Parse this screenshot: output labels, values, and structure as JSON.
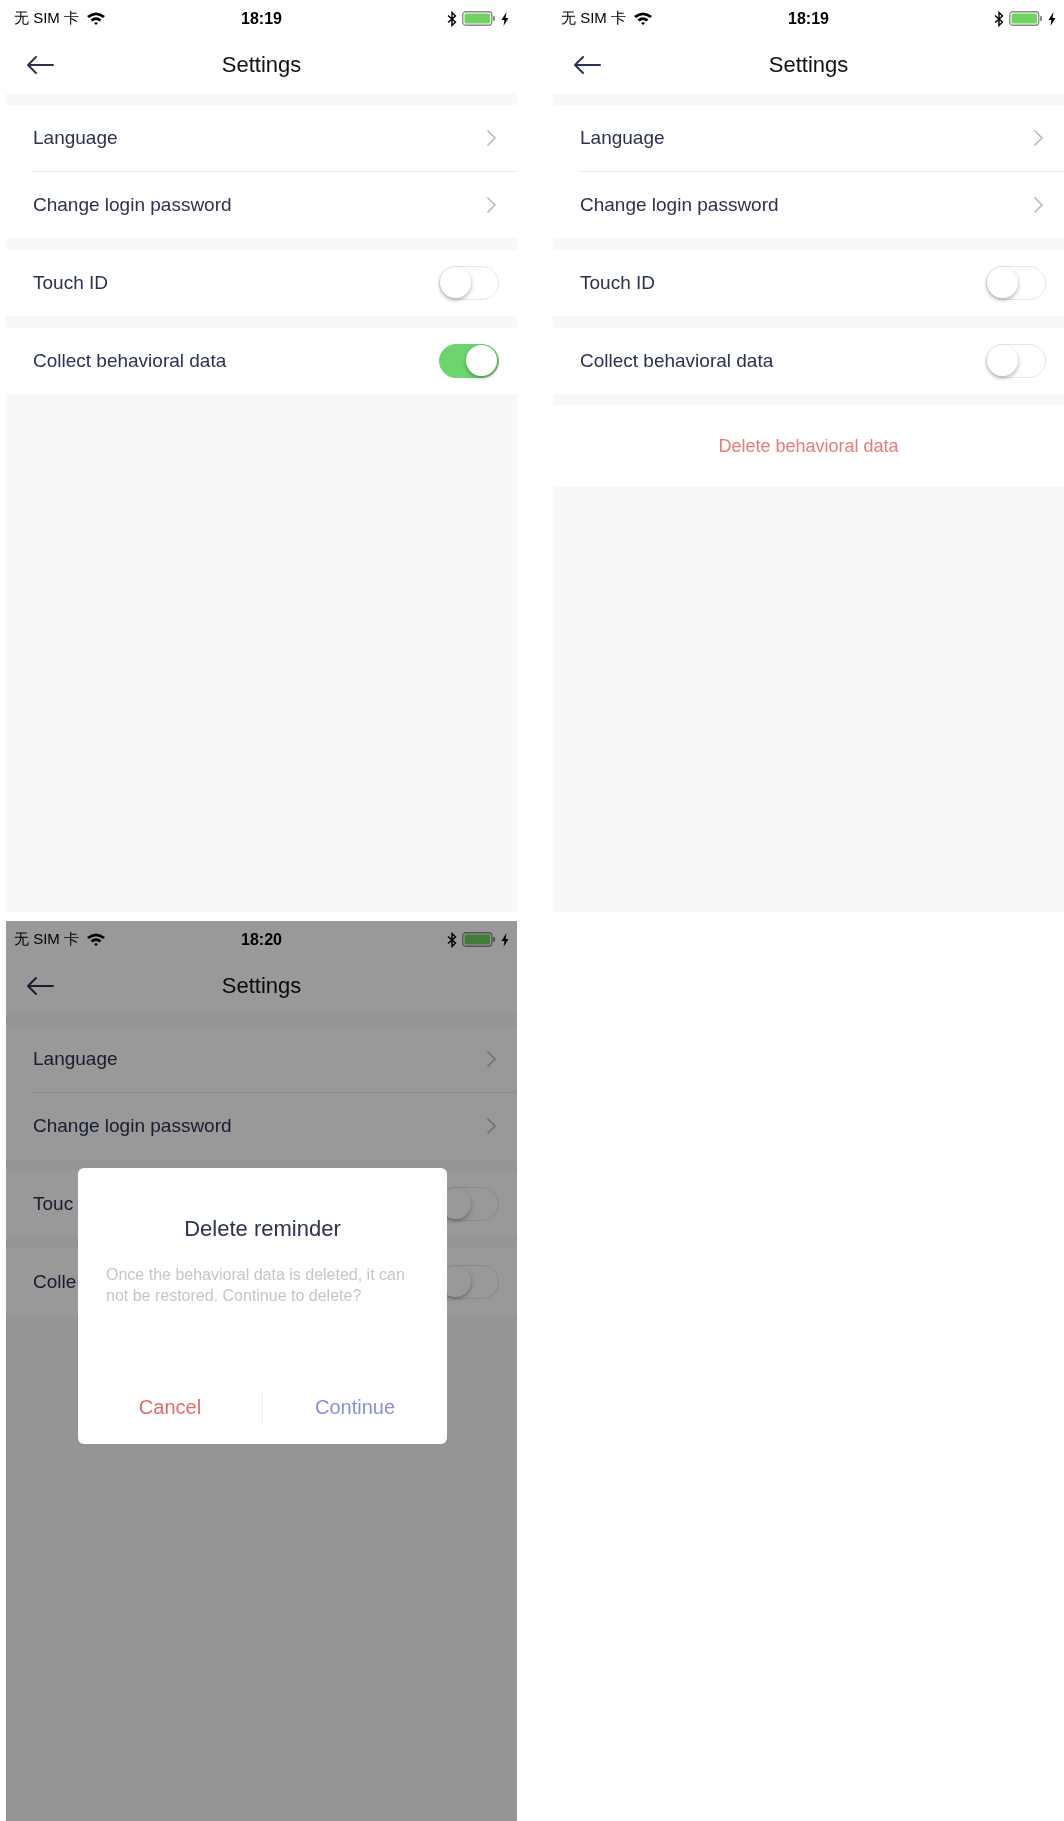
{
  "screens": [
    {
      "status_bar": {
        "carrier": "无 SIM 卡",
        "time": "18:19"
      },
      "title": "Settings",
      "groups": [
        {
          "items": [
            {
              "kind": "link",
              "label": "Language"
            },
            {
              "kind": "link",
              "label": "Change login password"
            }
          ]
        },
        {
          "items": [
            {
              "kind": "toggle",
              "label": "Touch ID",
              "on": false
            }
          ]
        },
        {
          "items": [
            {
              "kind": "toggle",
              "label": "Collect behavioral data",
              "on": true
            }
          ]
        }
      ]
    },
    {
      "status_bar": {
        "carrier": "无 SIM 卡",
        "time": "18:19"
      },
      "title": "Settings",
      "groups": [
        {
          "items": [
            {
              "kind": "link",
              "label": "Language"
            },
            {
              "kind": "link",
              "label": "Change login password"
            }
          ]
        },
        {
          "items": [
            {
              "kind": "toggle",
              "label": "Touch ID",
              "on": false
            }
          ]
        },
        {
          "items": [
            {
              "kind": "toggle",
              "label": "Collect behavioral data",
              "on": false
            }
          ]
        }
      ],
      "action": {
        "label": "Delete behavioral data"
      }
    },
    {
      "status_bar": {
        "carrier": "无 SIM 卡",
        "time": "18:20"
      },
      "title": "Settings",
      "groups": [
        {
          "items": [
            {
              "kind": "link",
              "label": "Language"
            },
            {
              "kind": "link",
              "label": "Change login password"
            }
          ]
        },
        {
          "items": [
            {
              "kind": "toggle",
              "label": "Touc",
              "on": false
            }
          ]
        },
        {
          "items": [
            {
              "kind": "toggle",
              "label": "Colle",
              "on": false
            }
          ]
        }
      ],
      "dialog": {
        "title": "Delete reminder",
        "message": "Once the behavioral data is deleted, it can not be restored. Continue to delete?",
        "buttons": [
          {
            "kind": "cancel",
            "label": "Cancel"
          },
          {
            "kind": "confirm",
            "label": "Continue"
          }
        ]
      }
    }
  ]
}
